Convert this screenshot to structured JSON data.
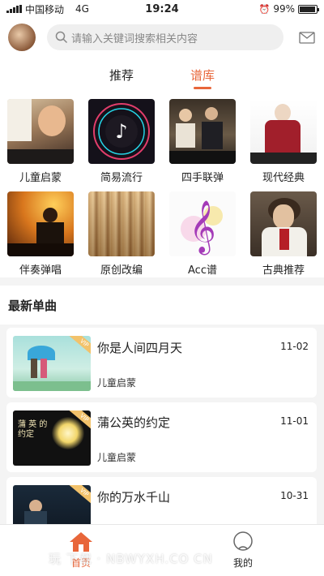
{
  "status_bar": {
    "carrier": "中国移动",
    "network": "4G",
    "time": "19:24",
    "battery": "99%"
  },
  "header": {
    "search_placeholder": "请输入关键词搜索相关内容"
  },
  "tabs": [
    {
      "label": "推荐",
      "active": false
    },
    {
      "label": "谱库",
      "active": true
    }
  ],
  "categories": [
    {
      "label": "儿童启蒙",
      "icon": "girl-piano-photo"
    },
    {
      "label": "简易流行",
      "icon": "tiktok-logo"
    },
    {
      "label": "四手联弹",
      "icon": "duet-piano-photo"
    },
    {
      "label": "现代经典",
      "icon": "pianist-photo"
    },
    {
      "label": "伴奏弹唱",
      "icon": "singer-piano-photo"
    },
    {
      "label": "原创改编",
      "icon": "sheet-music-photo"
    },
    {
      "label": "Acc谱",
      "icon": "treble-clef-icon"
    },
    {
      "label": "古典推荐",
      "icon": "beethoven-portrait"
    }
  ],
  "section": {
    "title": "最新单曲"
  },
  "songs": [
    {
      "title": "你是人间四月天",
      "date": "11-02",
      "category": "儿童启蒙",
      "badge": "VIP",
      "cover_text": ""
    },
    {
      "title": "蒲公英的约定",
      "date": "11-01",
      "category": "儿童启蒙",
      "badge": "VIP",
      "cover_text": "蒲 英 的约定"
    },
    {
      "title": "你的万水千山",
      "date": "10-31",
      "category": "",
      "badge": "VIP",
      "cover_text": ""
    }
  ],
  "bottom_nav": [
    {
      "label": "首页",
      "active": true
    },
    {
      "label": "我的",
      "active": false
    }
  ],
  "watermark": "玩 下载 · NBWYXH.CO CN",
  "colors": {
    "accent": "#e8663a",
    "background": "#f4f4f4",
    "card": "#ffffff"
  }
}
